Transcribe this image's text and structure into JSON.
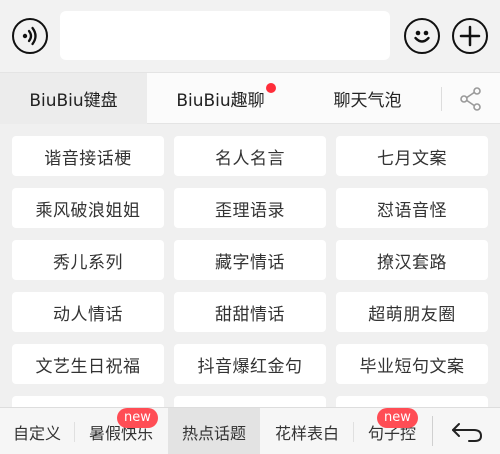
{
  "toolbar": {
    "voice_icon": "voice-icon",
    "emoji_icon": "smiley-icon",
    "plus_icon": "plus-icon",
    "input_value": ""
  },
  "tabs": [
    {
      "label": "BiuBiu键盘",
      "active": true
    },
    {
      "label": "BiuBiu趣聊",
      "active": false,
      "has_red_dot": true
    },
    {
      "label": "聊天气泡",
      "active": false
    }
  ],
  "share_icon": "share-icon",
  "grid": [
    "谐音接话梗",
    "名人名言",
    "七月文案",
    "乘风破浪姐姐",
    "歪理语录",
    "怼语音怪",
    "秀儿系列",
    "藏字情话",
    "撩汉套路",
    "动人情话",
    "甜甜情话",
    "超萌朋友圈",
    "文艺生日祝福",
    "抖音爆红金句",
    "毕业短句文案"
  ],
  "bottom_tabs": [
    {
      "label": "自定义",
      "active": false
    },
    {
      "label": "暑假快乐",
      "active": false,
      "badge": "new"
    },
    {
      "label": "热点话题",
      "active": true
    },
    {
      "label": "花样表白",
      "active": false
    },
    {
      "label": "句子控",
      "active": false,
      "badge": "new"
    }
  ],
  "back_icon": "back-arrow-icon",
  "colors": {
    "badge_red": "#ff4d55",
    "dot_red": "#ff2d3a"
  }
}
